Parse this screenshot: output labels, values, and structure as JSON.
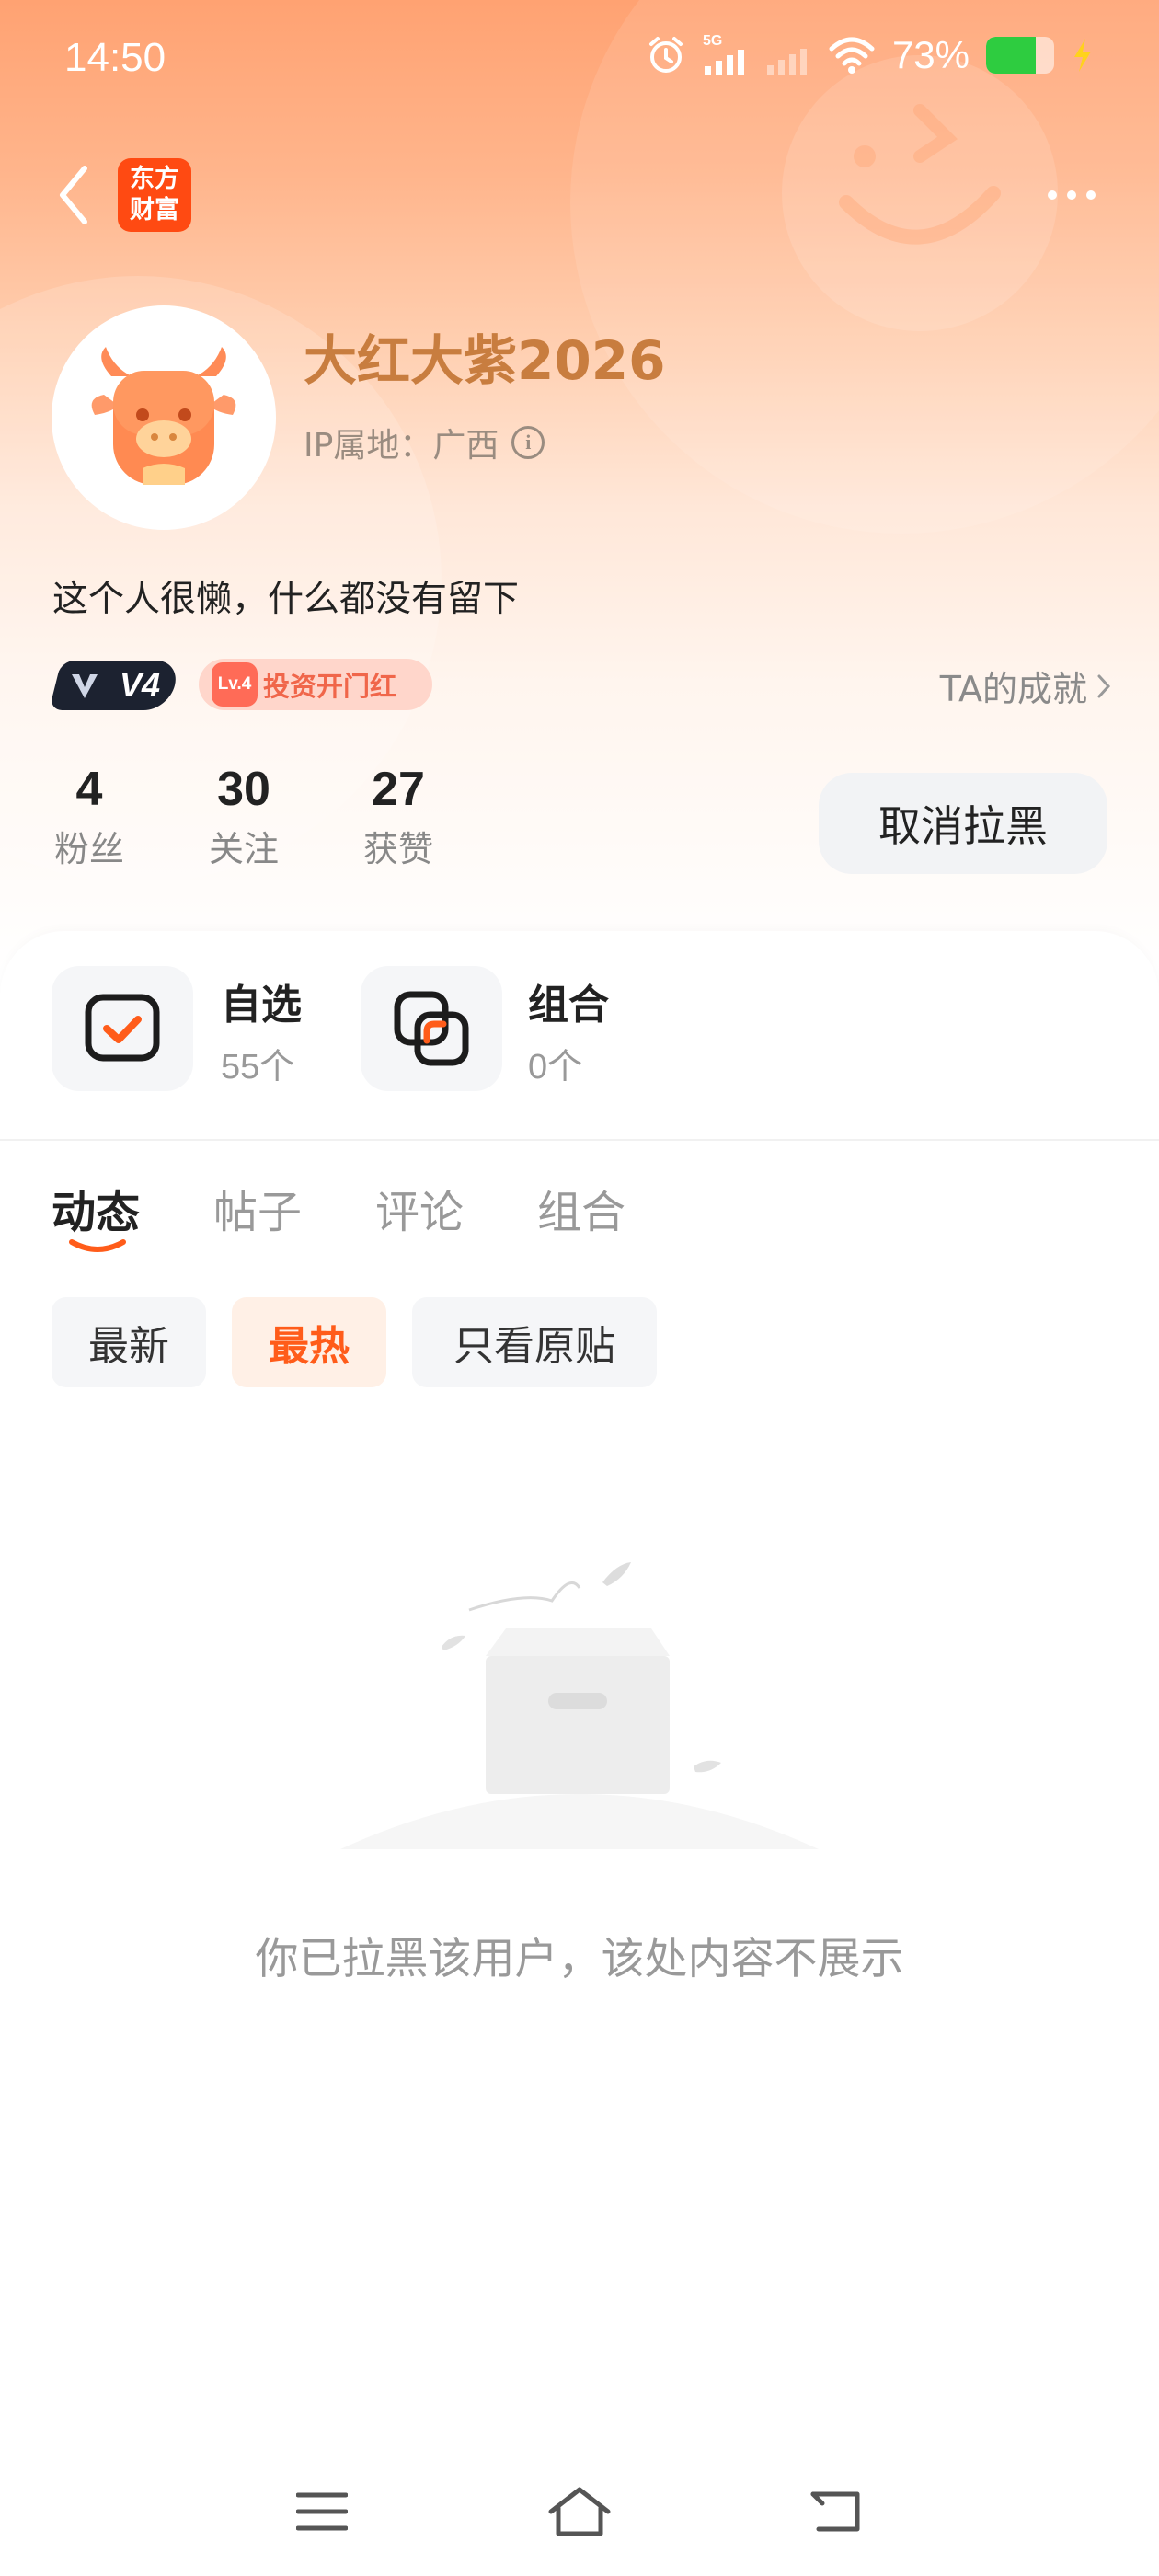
{
  "status_bar": {
    "time": "14:50",
    "network": "5G",
    "battery_percent": "73%",
    "battery_level": 0.73
  },
  "header": {
    "app_logo_text": "东方财富"
  },
  "profile": {
    "username": "大红大紫2026",
    "ip_location": "IP属地：广西",
    "bio": "这个人很懒，什么都没有留下",
    "vip_badge": "V4",
    "level_badge_lv": "Lv.4",
    "level_badge_title": "投资开门红",
    "achievement_link": "TA的成就"
  },
  "stats": [
    {
      "value": "4",
      "label": "粉丝"
    },
    {
      "value": "30",
      "label": "关注"
    },
    {
      "value": "27",
      "label": "获赞"
    }
  ],
  "unblock_button": "取消拉黑",
  "tiles": [
    {
      "title": "自选",
      "subtitle": "55个"
    },
    {
      "title": "组合",
      "subtitle": "0个"
    }
  ],
  "tabs": [
    {
      "label": "动态",
      "active": true
    },
    {
      "label": "帖子",
      "active": false
    },
    {
      "label": "评论",
      "active": false
    },
    {
      "label": "组合",
      "active": false
    }
  ],
  "filters": [
    {
      "label": "最新",
      "active": false
    },
    {
      "label": "最热",
      "active": true
    },
    {
      "label": "只看原贴",
      "active": false
    }
  ],
  "empty_message": "你已拉黑该用户，该处内容不展示",
  "colors": {
    "accent": "#ff5c1a",
    "username": "#c87d3f",
    "header_gradient_top": "#ffa272"
  }
}
